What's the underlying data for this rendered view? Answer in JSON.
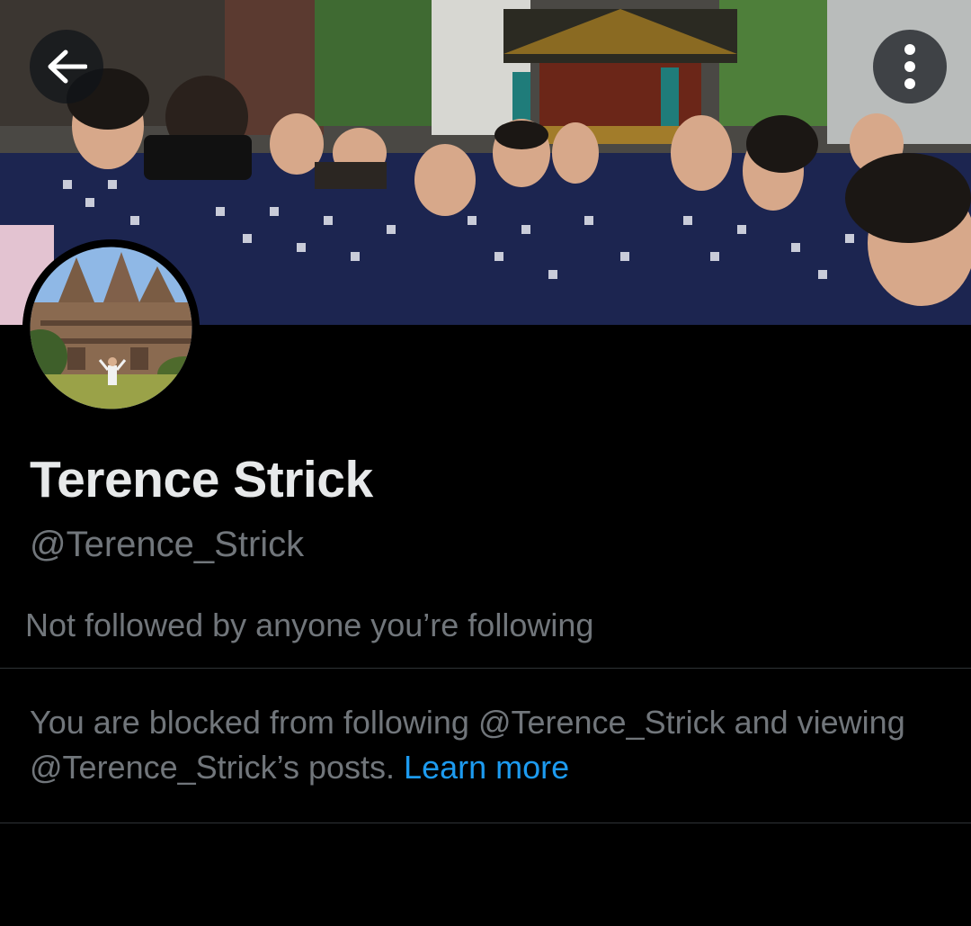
{
  "header": {
    "back_button_icon": "back-arrow-icon",
    "more_button_icon": "more-vertical-icon"
  },
  "profile": {
    "display_name": "Terence Strick",
    "handle": "@Terence_Strick",
    "followers_note": "Not followed by anyone you’re following"
  },
  "blocked": {
    "message_part1": "You are blocked from following @Terence_Strick and viewing @Terence_Strick’s posts. ",
    "link_label": "Learn more"
  },
  "colors": {
    "background": "#000000",
    "primary_text": "#e7e9ea",
    "secondary_text": "#71767b",
    "link": "#1d9bf0",
    "divider": "#2f3336"
  }
}
